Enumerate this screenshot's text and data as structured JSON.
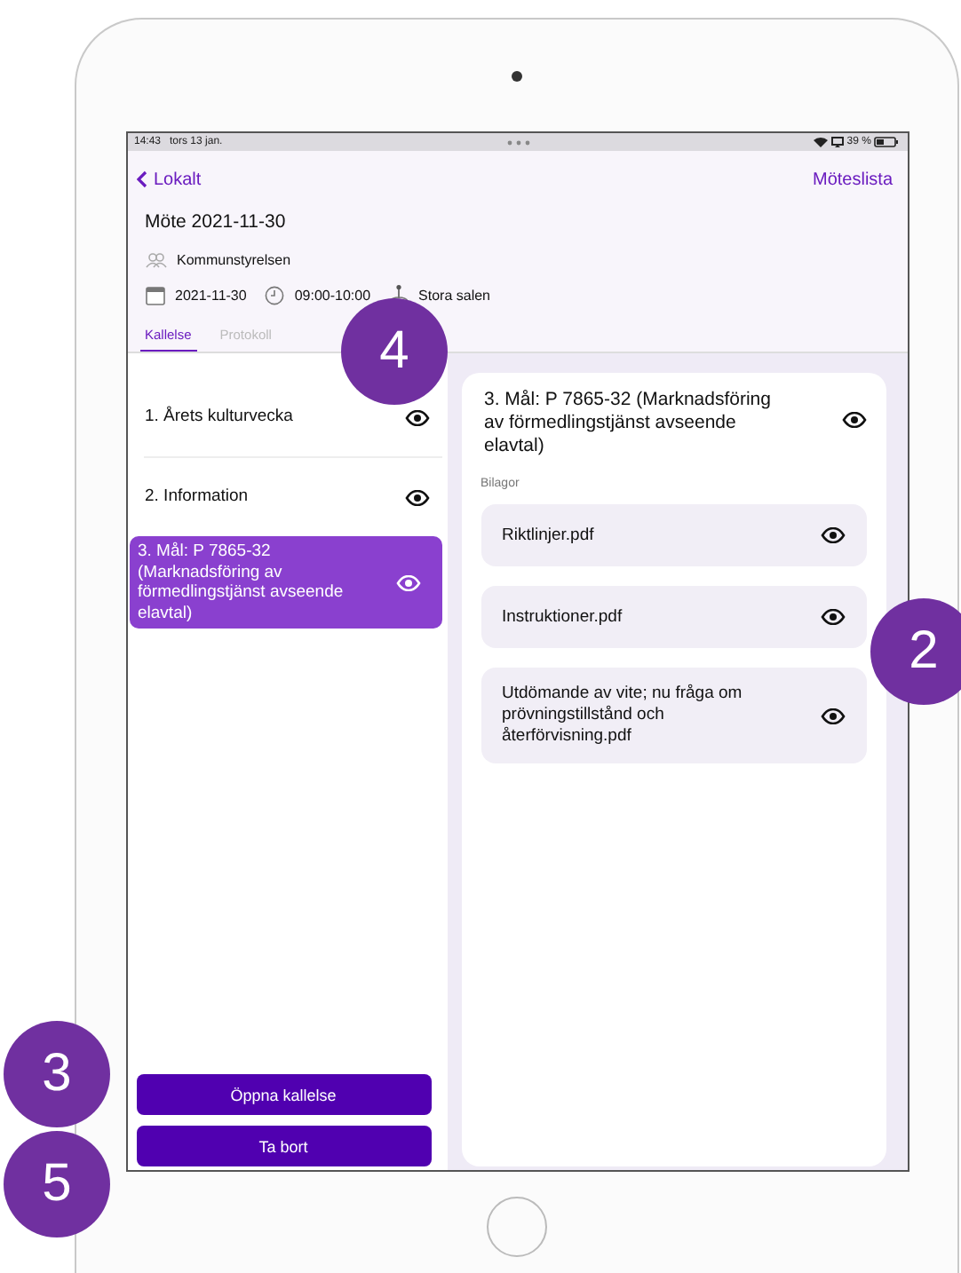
{
  "status_bar": {
    "time": "14:43",
    "date": "tors 13 jan.",
    "battery": "39 %"
  },
  "nav": {
    "back": "Lokalt",
    "right": "Möteslista"
  },
  "meeting": {
    "title": "Möte 2021-11-30",
    "committee": "Kommunstyrelsen",
    "date": "2021-11-30",
    "time": "09:00-10:00",
    "location": "Stora salen"
  },
  "tabs": [
    {
      "label": "Kallelse",
      "selected": true
    },
    {
      "label": "Protokoll",
      "selected": false
    }
  ],
  "agenda": [
    {
      "title": "1. Årets kulturvecka",
      "selected": false
    },
    {
      "title": "2. Information",
      "selected": false
    },
    {
      "title": "3. Mål: P 7865-32 (Marknadsföring av förmedlingstjänst avseende elavtal)",
      "selected": true
    }
  ],
  "detail": {
    "title": "3. Mål: P 7865-32 (Marknadsföring av förmedlingstjänst avseende elavtal)",
    "attachments_label": "Bilagor",
    "attachments": [
      "Riktlinjer.pdf",
      "Instruktioner.pdf",
      "Utdömande av vite; nu fråga om prövningstillstånd och återförvisning.pdf"
    ]
  },
  "buttons": [
    "Öppna kallelse",
    "Ta bort"
  ],
  "callouts": [
    {
      "label": "4"
    },
    {
      "label": "2"
    },
    {
      "label": "3"
    },
    {
      "label": "5"
    }
  ]
}
